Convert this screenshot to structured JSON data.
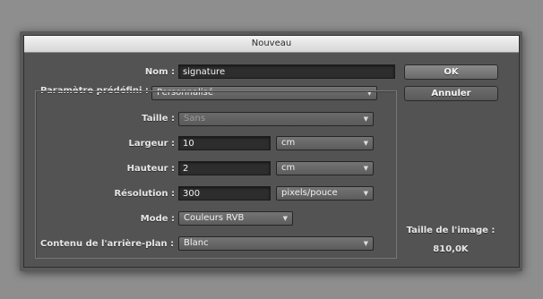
{
  "dialog": {
    "title": "Nouveau"
  },
  "name": {
    "label": "Nom :",
    "value": "signature"
  },
  "preset": {
    "label": "Paramètre prédéfini :",
    "value": "Personnalisé"
  },
  "size": {
    "label": "Taille :",
    "value": "Sans"
  },
  "width": {
    "label": "Largeur :",
    "value": "10",
    "unit": "cm"
  },
  "height": {
    "label": "Hauteur :",
    "value": "2",
    "unit": "cm"
  },
  "resolution": {
    "label": "Résolution :",
    "value": "300",
    "unit": "pixels/pouce"
  },
  "mode": {
    "label": "Mode :",
    "value": "Couleurs RVB"
  },
  "background": {
    "label": "Contenu de l'arrière-plan :",
    "value": "Blanc"
  },
  "buttons": {
    "ok": "OK",
    "cancel": "Annuler"
  },
  "image_size": {
    "label": "Taille de l'image :",
    "value": "810,0K"
  },
  "icons": {
    "dropdown": "chevron-down-icon"
  }
}
